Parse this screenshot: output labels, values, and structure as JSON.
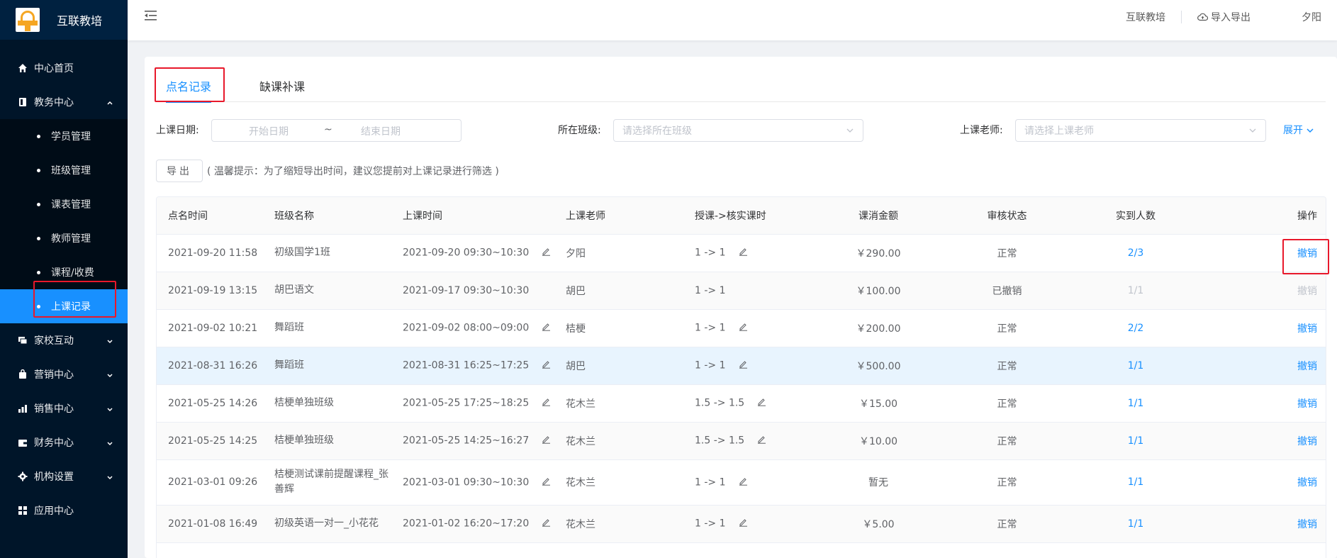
{
  "app": {
    "title": "互联教培"
  },
  "sidebar": {
    "items": [
      {
        "label": "中心首页",
        "icon": "home-icon"
      },
      {
        "label": "教务中心",
        "icon": "book-icon",
        "expanded": true,
        "children": [
          {
            "label": "学员管理"
          },
          {
            "label": "班级管理"
          },
          {
            "label": "课表管理"
          },
          {
            "label": "教师管理"
          },
          {
            "label": "课程/收费"
          },
          {
            "label": "上课记录",
            "active": true
          }
        ]
      },
      {
        "label": "家校互动",
        "icon": "chat-icon"
      },
      {
        "label": "营销中心",
        "icon": "bag-icon"
      },
      {
        "label": "销售中心",
        "icon": "chart-icon"
      },
      {
        "label": "财务中心",
        "icon": "wallet-icon"
      },
      {
        "label": "机构设置",
        "icon": "gear-icon"
      },
      {
        "label": "应用中心",
        "icon": "grid-icon"
      }
    ]
  },
  "header": {
    "org": "互联教培",
    "import_export": "导入导出",
    "user": "夕阳"
  },
  "tabs": [
    {
      "label": "点名记录",
      "active": true
    },
    {
      "label": "缺课补课"
    }
  ],
  "filters": {
    "date_label": "上课日期:",
    "start_placeholder": "开始日期",
    "range_sep": "~",
    "end_placeholder": "结束日期",
    "class_label": "所在班级:",
    "class_placeholder": "请选择所在班级",
    "teacher_label": "上课老师:",
    "teacher_placeholder": "请选择上课老师",
    "expand": "展开"
  },
  "toolbar": {
    "export": "导出",
    "hint": "( 温馨提示：为了缩短导出时间，建议您提前对上课记录进行筛选 )"
  },
  "table": {
    "columns": [
      "点名时间",
      "班级名称",
      "上课时间",
      "上课老师",
      "授课->核实课时",
      "课消金额",
      "审核状态",
      "实到人数",
      "操作"
    ],
    "rows": [
      {
        "time": "2021-09-20 11:58",
        "class": "初级国学1班",
        "session": "2021-09-20 09:30~10:30",
        "teacher": "夕阳",
        "hours": "1 -> 1",
        "amount": "￥290.00",
        "status": "正常",
        "attend": "2/3",
        "action": "撤销",
        "editable": true
      },
      {
        "time": "2021-09-19 13:15",
        "class": "胡巴语文",
        "session": "2021-09-17 09:30~10:30",
        "teacher": "胡巴",
        "hours": "1 -> 1",
        "amount": "￥100.00",
        "status": "已撤销",
        "attend": "1/1",
        "action": "撤销",
        "editable": false
      },
      {
        "time": "2021-09-02 10:21",
        "class": "舞蹈班",
        "session": "2021-09-02 08:00~09:00",
        "teacher": "桔梗",
        "hours": "1 -> 1",
        "amount": "￥200.00",
        "status": "正常",
        "attend": "2/2",
        "action": "撤销",
        "editable": true
      },
      {
        "time": "2021-08-31 16:26",
        "class": "舞蹈班",
        "session": "2021-08-31 16:25~17:25",
        "teacher": "胡巴",
        "hours": "1 -> 1",
        "amount": "￥500.00",
        "status": "正常",
        "attend": "1/1",
        "action": "撤销",
        "editable": true
      },
      {
        "time": "2021-05-25 14:26",
        "class": "桔梗单独班级",
        "session": "2021-05-25 17:25~18:25",
        "teacher": "花木兰",
        "hours": "1.5 -> 1.5",
        "amount": "￥15.00",
        "status": "正常",
        "attend": "1/1",
        "action": "撤销",
        "editable": true
      },
      {
        "time": "2021-05-25 14:25",
        "class": "桔梗单独班级",
        "session": "2021-05-25 14:25~16:27",
        "teacher": "花木兰",
        "hours": "1.5 -> 1.5",
        "amount": "￥10.00",
        "status": "正常",
        "attend": "1/1",
        "action": "撤销",
        "editable": true
      },
      {
        "time": "2021-03-01 09:26",
        "class": "桔梗测试课前提醒课程_张善辉",
        "session": "2021-03-01 09:30~10:30",
        "teacher": "花木兰",
        "hours": "1 -> 1",
        "amount": "暂无",
        "status": "正常",
        "attend": "1/1",
        "action": "撤销",
        "editable": true
      },
      {
        "time": "2021-01-08 16:49",
        "class": "初级英语一对一_小花花",
        "session": "2021-01-02 16:20~17:20",
        "teacher": "花木兰",
        "hours": "1 -> 1",
        "amount": "￥5.00",
        "status": "正常",
        "attend": "1/1",
        "action": "撤销",
        "editable": true
      }
    ]
  },
  "colors": {
    "accent": "#1890ff",
    "sidebar_bg": "#001529",
    "highlight_box": "#e8182b"
  }
}
